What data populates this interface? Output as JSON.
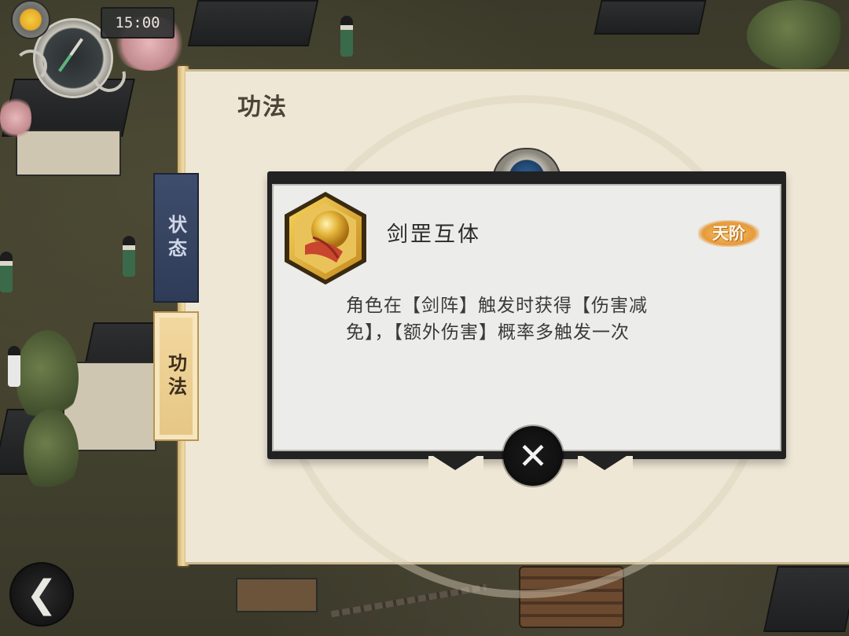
{
  "hud": {
    "time": "15:00",
    "compass_icon": "compass-icon",
    "sun_icon": "sun-icon"
  },
  "panel": {
    "title": "功法"
  },
  "tabs": [
    {
      "label": "状态",
      "active": false
    },
    {
      "label": "功法",
      "active": true
    }
  ],
  "skill": {
    "name": "剑罡互体",
    "tier": "天阶",
    "description_line1": "角色在【剑阵】触发时获得【伤害减",
    "description_line2": "免】，【额外伤害】概率多触发一次",
    "icon": "golden-orb-hexagon-icon"
  },
  "buttons": {
    "close_icon": "close-icon",
    "back_icon": "back-arrow-icon"
  },
  "colors": {
    "panel_bg": "#efe7d6",
    "tab_active": "#e6c684",
    "tab_inactive": "#2f3c58",
    "tier_badge": "#e79a3a"
  }
}
